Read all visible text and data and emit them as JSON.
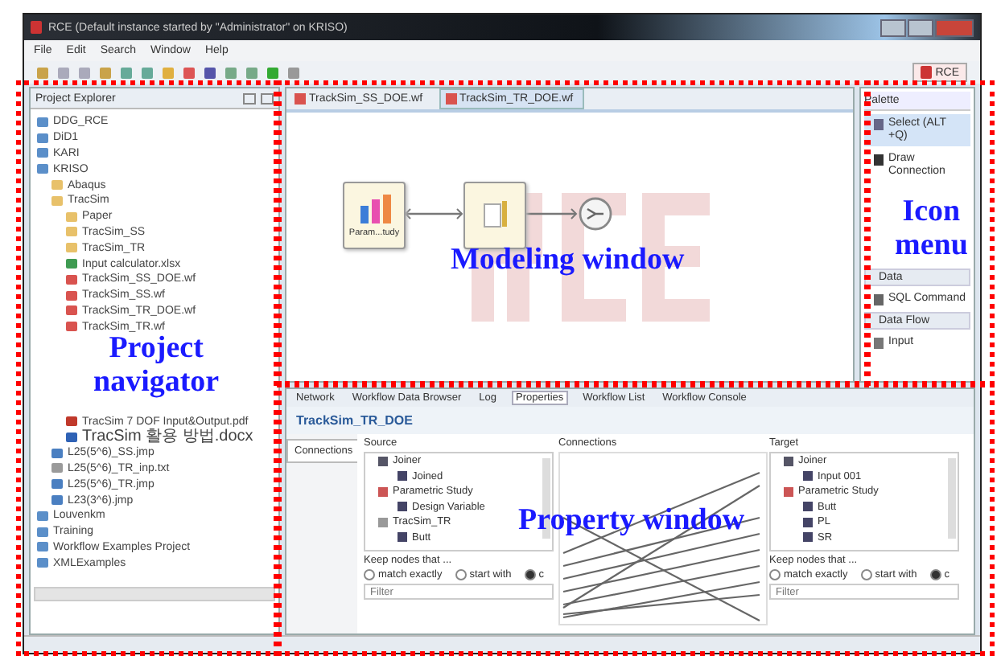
{
  "window": {
    "title": "RCE (Default instance started by \"Administrator\" on KRISO)"
  },
  "menu": [
    "File",
    "Edit",
    "Search",
    "Window",
    "Help"
  ],
  "toolbar": {
    "perspective": "RCE"
  },
  "project_explorer": {
    "title": "Project Explorer",
    "tree": [
      {
        "kind": "project",
        "label": "DDG_RCE"
      },
      {
        "kind": "project",
        "label": "DiD1"
      },
      {
        "kind": "project",
        "label": "KARI"
      },
      {
        "kind": "project",
        "label": "KRISO",
        "children": [
          {
            "kind": "folder",
            "label": "Abaqus"
          },
          {
            "kind": "folder",
            "label": "TracSim",
            "children": [
              {
                "kind": "folder",
                "label": "Paper"
              },
              {
                "kind": "folder",
                "label": "TracSim_SS"
              },
              {
                "kind": "folder",
                "label": "TracSim_TR"
              },
              {
                "kind": "excel",
                "label": "Input calculator.xlsx"
              },
              {
                "kind": "workflow",
                "label": "TrackSim_SS_DOE.wf"
              },
              {
                "kind": "workflow",
                "label": "TrackSim_SS.wf"
              },
              {
                "kind": "workflow",
                "label": "TrackSim_TR_DOE.wf"
              },
              {
                "kind": "workflow",
                "label": "TrackSim_TR.wf"
              },
              {
                "kind": "covered"
              },
              {
                "kind": "covered"
              },
              {
                "kind": "covered"
              },
              {
                "kind": "covered"
              },
              {
                "kind": "covered"
              },
              {
                "kind": "pdf",
                "label": "TracSim 7 DOF Input&Output.pdf"
              },
              {
                "kind": "word",
                "label": "TracSim 활용 방법.docx"
              }
            ]
          },
          {
            "kind": "jmp",
            "label": "L25(5^6)_SS.jmp"
          },
          {
            "kind": "text",
            "label": "L25(5^6)_TR_inp.txt"
          },
          {
            "kind": "jmp",
            "label": "L25(5^6)_TR.jmp"
          },
          {
            "kind": "jmp",
            "label": "L23(3^6).jmp"
          }
        ]
      },
      {
        "kind": "project",
        "label": "Louvenkm"
      },
      {
        "kind": "project",
        "label": "Training"
      },
      {
        "kind": "project",
        "label": "Workflow Examples Project"
      },
      {
        "kind": "project",
        "label": "XMLExamples"
      }
    ]
  },
  "editor": {
    "tabs": [
      {
        "label": "TrackSim_SS_DOE.wf",
        "selected": false
      },
      {
        "label": "TrackSim_TR_DOE.wf",
        "selected": true
      }
    ],
    "nodes": [
      {
        "kind": "parametric",
        "label": "Param...tudy"
      },
      {
        "kind": "tool"
      },
      {
        "kind": "joiner"
      }
    ]
  },
  "palette": {
    "title": "Palette",
    "groups": [
      {
        "items": [
          {
            "kind": "select",
            "label": "Select (ALT +Q)",
            "selected": true
          },
          {
            "kind": "connect",
            "label": "Draw Connection",
            "selected": false
          }
        ]
      },
      {
        "kind": "covered"
      },
      {
        "label": "Data",
        "items": [
          {
            "kind": "sql",
            "label": "SQL Command",
            "selected": false
          }
        ]
      },
      {
        "label": "Data Flow",
        "items": [
          {
            "kind": "input",
            "label": "Input",
            "selected": false
          }
        ]
      }
    ]
  },
  "properties": {
    "tabs": [
      {
        "label": "Network",
        "selected": false
      },
      {
        "label": "Workflow Data Browser",
        "selected": false
      },
      {
        "label": "Log",
        "selected": false
      },
      {
        "label": "Properties",
        "selected": true
      },
      {
        "label": "Workflow List",
        "selected": false
      },
      {
        "label": "Workflow Console",
        "selected": false
      }
    ],
    "title": "TrackSim_TR_DOE",
    "side_tabs": [
      {
        "label": "Connections",
        "selected": true
      }
    ],
    "source": {
      "header": "Source",
      "items": [
        {
          "kind": "component",
          "label": "Joiner"
        },
        {
          "kind": "port",
          "label": "Joined"
        },
        {
          "kind": "study",
          "label": "Parametric Study"
        },
        {
          "kind": "port",
          "label": "Design Variable"
        },
        {
          "kind": "tool",
          "label": "TracSim_TR"
        },
        {
          "kind": "port",
          "label": "Butt"
        }
      ],
      "filter_label": "Keep nodes that ...",
      "options": [
        {
          "label": "match exactly",
          "selected": false
        },
        {
          "label": "start with",
          "selected": false
        },
        {
          "label": "c",
          "selected": true
        }
      ],
      "filter": {
        "placeholder": "Filter"
      }
    },
    "connections": {
      "header": "Connections"
    },
    "target": {
      "header": "Target",
      "items": [
        {
          "kind": "component",
          "label": "Joiner"
        },
        {
          "kind": "port",
          "label": "Input 001"
        },
        {
          "kind": "study",
          "label": "Parametric Study"
        },
        {
          "kind": "port",
          "label": "Butt"
        },
        {
          "kind": "port",
          "label": "PL"
        },
        {
          "kind": "port",
          "label": "SR"
        }
      ],
      "filter_label": "Keep nodes that ...",
      "options": [
        {
          "label": "match exactly",
          "selected": false
        },
        {
          "label": "start with",
          "selected": false
        },
        {
          "label": "c",
          "selected": true
        }
      ],
      "filter": {
        "placeholder": "Filter"
      }
    }
  },
  "annotations": [
    {
      "text": "Project navigator"
    },
    {
      "text": "Modeling window"
    },
    {
      "text": "Icon menu"
    },
    {
      "text": "Property window"
    }
  ]
}
